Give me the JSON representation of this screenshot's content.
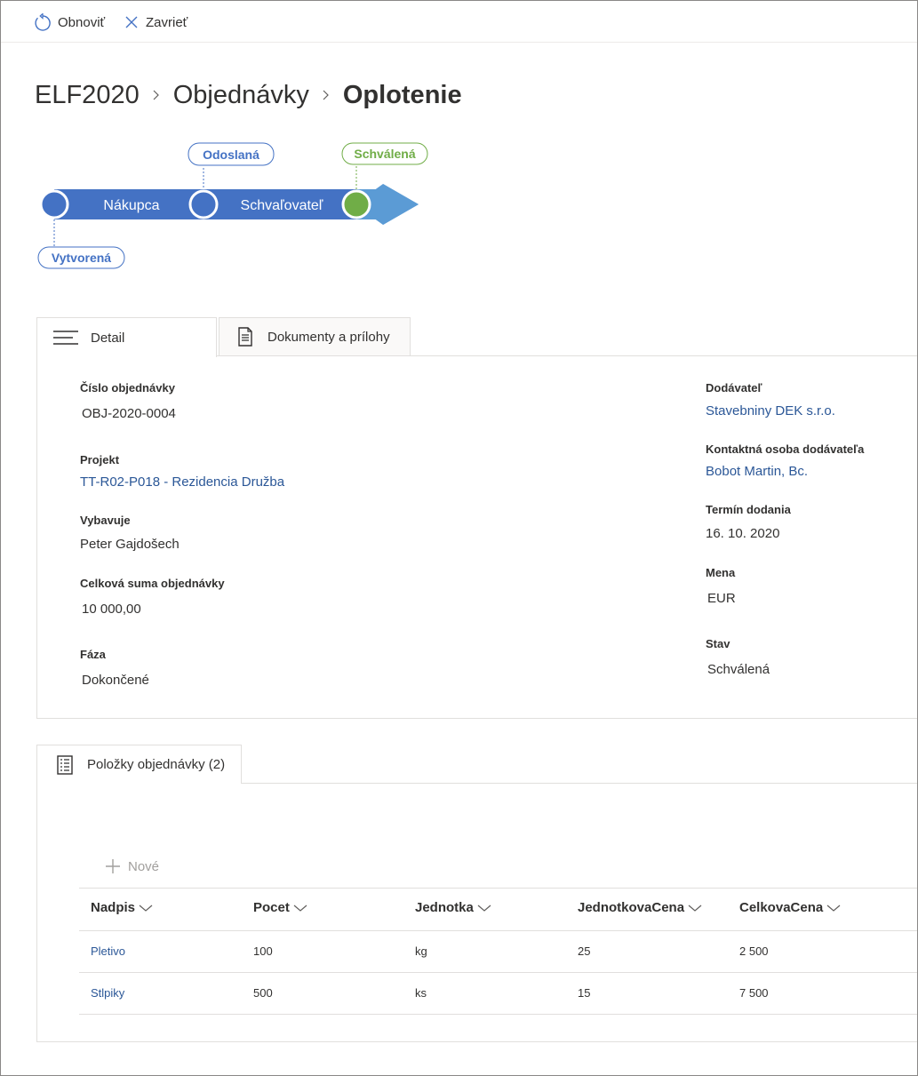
{
  "toolbar": {
    "refresh_label": "Obnoviť",
    "close_label": "Zavrieť"
  },
  "breadcrumb": {
    "items": [
      "ELF2020",
      "Objednávky"
    ],
    "current": "Oplotenie"
  },
  "workflow": {
    "stage_1": "Nákupca",
    "stage_2": "Schvaľovateľ",
    "status_created": "Vytvorená",
    "status_sent": "Odoslaná",
    "status_approved": "Schválená"
  },
  "detail_tabs": {
    "detail": "Detail",
    "documents": "Dokumenty a prílohy"
  },
  "detail": {
    "order_number_label": "Číslo objednávky",
    "order_number": "OBJ-2020-0004",
    "project_label": "Projekt",
    "project": "TT-R02-P018 - Rezidencia Družba",
    "handled_by_label": "Vybavuje",
    "handled_by": "Peter Gajdošech",
    "total_label": "Celková suma objednávky",
    "total": "10 000,00",
    "phase_label": "Fáza",
    "phase": "Dokončené",
    "supplier_label": "Dodávateľ",
    "supplier": "Stavebniny DEK s.r.o.",
    "contact_label": "Kontaktná osoba dodávateľa",
    "contact": "Bobot Martin, Bc.",
    "delivery_label": "Termín dodania",
    "delivery": "16. 10. 2020",
    "currency_label": "Mena",
    "currency": "EUR",
    "state_label": "Stav",
    "state": "Schválená"
  },
  "items_tab": {
    "label": "Položky objednávky (2)"
  },
  "items": {
    "new_label": "Nové",
    "columns": [
      "Nadpis",
      "Pocet",
      "Jednotka",
      "JednotkovaCena",
      "CelkovaCena"
    ],
    "rows": [
      [
        "Pletivo",
        "100",
        "kg",
        "25",
        "2 500"
      ],
      [
        "Stlpiky",
        "500",
        "ks",
        "15",
        "7 500"
      ]
    ]
  },
  "colors": {
    "accent": "#4472c4",
    "arrow": "#5b9bd5",
    "approved": "#70ad47",
    "link": "#2b5797"
  }
}
